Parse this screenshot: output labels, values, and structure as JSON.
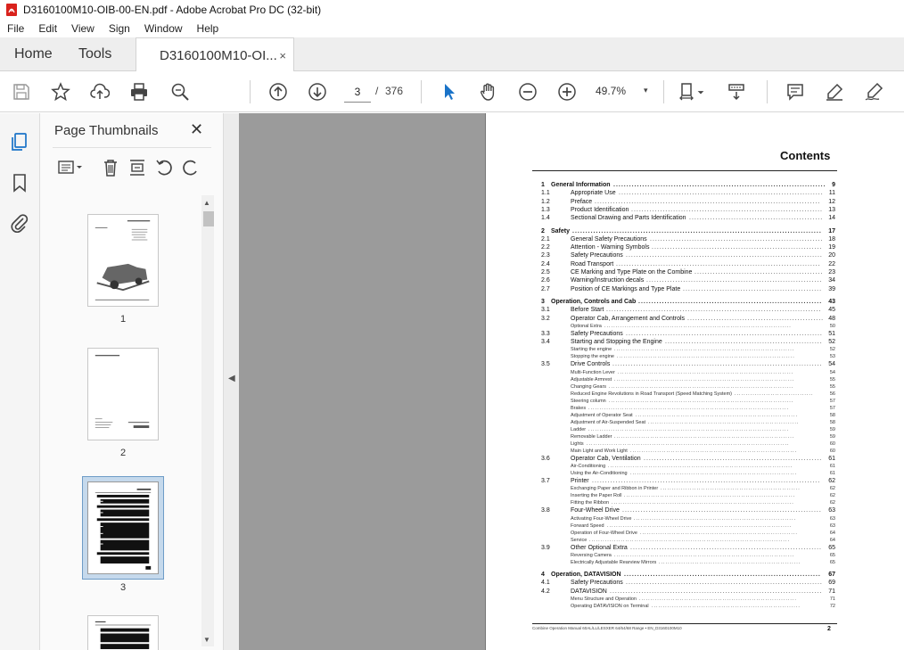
{
  "window": {
    "title": "D3160100M10-OIB-00-EN.pdf - Adobe Acrobat Pro DC (32-bit)"
  },
  "menu": {
    "items": [
      "File",
      "Edit",
      "View",
      "Sign",
      "Window",
      "Help"
    ]
  },
  "tabs": {
    "home": "Home",
    "tools": "Tools",
    "document": "D3160100M10-OI...",
    "close": "×"
  },
  "toolbar": {
    "current_page": "3",
    "separator": "/",
    "total_pages": "376",
    "zoom": "49.7%",
    "zoom_caret": "▾"
  },
  "panel": {
    "title": "Page Thumbnails",
    "close": "✕",
    "thumbnails": [
      {
        "label": "1"
      },
      {
        "label": "2"
      },
      {
        "label": "3"
      }
    ]
  },
  "document": {
    "heading": "Contents",
    "footer_left": "Combine Operation Manual 60AL/LL/LESXER 64/64/68 Range • EN_D3160100M10",
    "footer_page": "2",
    "toc": [
      {
        "num": "1",
        "text": "General Information",
        "page": "9",
        "kind": "chap"
      },
      {
        "num": "1.1",
        "text": "Appropriate Use",
        "page": "11",
        "kind": "sec"
      },
      {
        "num": "1.2",
        "text": "Preface",
        "page": "12",
        "kind": "sec"
      },
      {
        "num": "1.3",
        "text": "Product Identification",
        "page": "13",
        "kind": "sec"
      },
      {
        "num": "1.4",
        "text": "Sectional Drawing and Parts Identification",
        "page": "14",
        "kind": "sec"
      },
      {
        "num": "2",
        "text": "Safety",
        "page": "17",
        "kind": "chap"
      },
      {
        "num": "2.1",
        "text": "General Safety Precautions",
        "page": "18",
        "kind": "sec"
      },
      {
        "num": "2.2",
        "text": "Attention - Warning Symbols",
        "page": "19",
        "kind": "sec"
      },
      {
        "num": "2.3",
        "text": "Safety Precautions",
        "page": "20",
        "kind": "sec"
      },
      {
        "num": "2.4",
        "text": "Road Transport",
        "page": "22",
        "kind": "sec"
      },
      {
        "num": "2.5",
        "text": "CE Marking and Type Plate on the Combine",
        "page": "23",
        "kind": "sec"
      },
      {
        "num": "2.6",
        "text": "Warning/Instruction decals",
        "page": "34",
        "kind": "sec"
      },
      {
        "num": "2.7",
        "text": "Position of CE Markings and Type Plate",
        "page": "39",
        "kind": "sec"
      },
      {
        "num": "3",
        "text": "Operation, Controls and Cab",
        "page": "43",
        "kind": "chap"
      },
      {
        "num": "3.1",
        "text": "Before Start",
        "page": "45",
        "kind": "sec"
      },
      {
        "num": "3.2",
        "text": "Operator Cab, Arrangement and Controls",
        "page": "48",
        "kind": "sec"
      },
      {
        "num": "",
        "text": "Optional Extra",
        "page": "50",
        "kind": "small"
      },
      {
        "num": "3.3",
        "text": "Safety Precautions",
        "page": "51",
        "kind": "sec"
      },
      {
        "num": "3.4",
        "text": "Starting and Stopping the Engine",
        "page": "52",
        "kind": "sec"
      },
      {
        "num": "",
        "text": "Starting the engine",
        "page": "52",
        "kind": "small"
      },
      {
        "num": "",
        "text": "Stopping the engine",
        "page": "53",
        "kind": "small"
      },
      {
        "num": "3.5",
        "text": "Drive Controls",
        "page": "54",
        "kind": "sec"
      },
      {
        "num": "",
        "text": "Multi-Function Lever",
        "page": "54",
        "kind": "small"
      },
      {
        "num": "",
        "text": "Adjustable Armrest",
        "page": "55",
        "kind": "small"
      },
      {
        "num": "",
        "text": "Changing Gears",
        "page": "55",
        "kind": "small"
      },
      {
        "num": "",
        "text": "Reduced Engine Revolutions in Road Transport (Speed Matching System)",
        "page": "56",
        "kind": "small"
      },
      {
        "num": "",
        "text": "Steering column",
        "page": "57",
        "kind": "small"
      },
      {
        "num": "",
        "text": "Brakes",
        "page": "57",
        "kind": "small"
      },
      {
        "num": "",
        "text": "Adjustment of Operator Seat",
        "page": "58",
        "kind": "small"
      },
      {
        "num": "",
        "text": "Adjustment of Air-Suspended Seat",
        "page": "58",
        "kind": "small"
      },
      {
        "num": "",
        "text": "Ladder",
        "page": "59",
        "kind": "small"
      },
      {
        "num": "",
        "text": "Removable Ladder",
        "page": "59",
        "kind": "small"
      },
      {
        "num": "",
        "text": "Lights",
        "page": "60",
        "kind": "small"
      },
      {
        "num": "",
        "text": "Main Light and Work Light",
        "page": "60",
        "kind": "small"
      },
      {
        "num": "3.6",
        "text": "Operator Cab, Ventilation",
        "page": "61",
        "kind": "sec"
      },
      {
        "num": "",
        "text": "Air-Conditioning",
        "page": "61",
        "kind": "small"
      },
      {
        "num": "",
        "text": "Using the Air-Conditioning",
        "page": "61",
        "kind": "small"
      },
      {
        "num": "3.7",
        "text": "Printer",
        "page": "62",
        "kind": "sec"
      },
      {
        "num": "",
        "text": "Exchanging Paper and Ribbon in Printer",
        "page": "62",
        "kind": "small"
      },
      {
        "num": "",
        "text": "Inserting the Paper Roll",
        "page": "62",
        "kind": "small"
      },
      {
        "num": "",
        "text": "Fitting the Ribbon",
        "page": "62",
        "kind": "small"
      },
      {
        "num": "3.8",
        "text": "Four-Wheel Drive",
        "page": "63",
        "kind": "sec"
      },
      {
        "num": "",
        "text": "Activating Four-Wheel Drive",
        "page": "63",
        "kind": "small"
      },
      {
        "num": "",
        "text": "Forward Speed",
        "page": "63",
        "kind": "small"
      },
      {
        "num": "",
        "text": "Operation of Four-Wheel Drive",
        "page": "64",
        "kind": "small"
      },
      {
        "num": "",
        "text": "Service",
        "page": "64",
        "kind": "small"
      },
      {
        "num": "3.9",
        "text": "Other Optional Extra",
        "page": "65",
        "kind": "sec"
      },
      {
        "num": "",
        "text": "Reversing Camera",
        "page": "65",
        "kind": "small"
      },
      {
        "num": "",
        "text": "Electrically Adjustable Rearview Mirrors",
        "page": "65",
        "kind": "small"
      },
      {
        "num": "4",
        "text": "Operation, DATAVISION",
        "page": "67",
        "kind": "chap"
      },
      {
        "num": "4.1",
        "text": "Safety Precautions",
        "page": "69",
        "kind": "sec"
      },
      {
        "num": "4.2",
        "text": "DATAVISION",
        "page": "71",
        "kind": "sec"
      },
      {
        "num": "",
        "text": "Menu Structure and Operation",
        "page": "71",
        "kind": "small"
      },
      {
        "num": "",
        "text": "Operating DATAVISION on Terminal",
        "page": "72",
        "kind": "small"
      }
    ]
  },
  "colors": {
    "doc_background": "#9b9b9b",
    "accent": "#1a73c8",
    "app_icon_red": "#d9221c"
  }
}
